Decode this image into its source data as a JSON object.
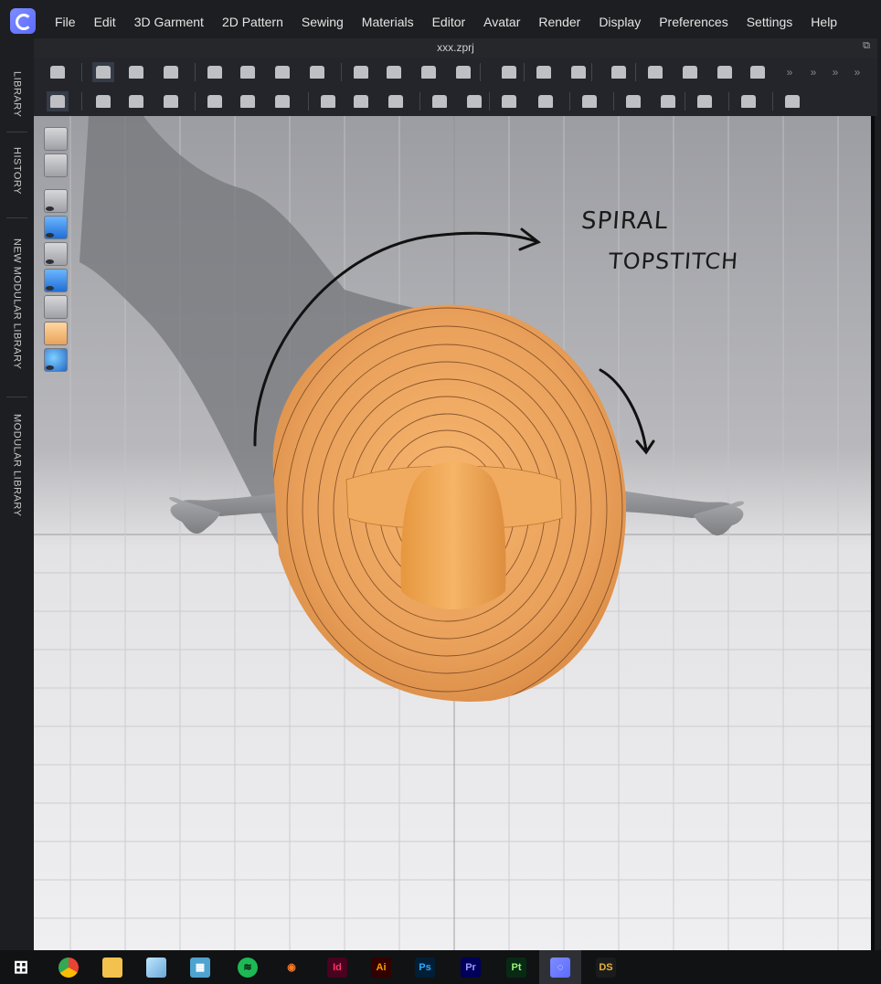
{
  "menubar": {
    "items": [
      "File",
      "Edit",
      "3D Garment",
      "2D Pattern",
      "Sewing",
      "Materials",
      "Editor",
      "Avatar",
      "Render",
      "Display",
      "Preferences",
      "Settings",
      "Help"
    ]
  },
  "sidebar": {
    "tabs": [
      "LIBRARY",
      "HISTORY",
      "NEW MODULAR LIBRARY",
      "MODULAR LIBRARY"
    ]
  },
  "file": {
    "title": "xxx.zprj"
  },
  "toolbar1": {
    "icons": [
      "import-icon",
      "transform-pattern-icon",
      "edit-pattern-icon",
      "transform-box-icon",
      "garment-simulate-icon",
      "garment-tuck-icon",
      "garment-fold-icon",
      "garment-strengthen-icon",
      "pin-icon",
      "fold-arrangement-icon",
      "fold-pattern-icon",
      "arrange-icon",
      "topstitch-icon",
      "button-tool-icon",
      "zipper-icon",
      "avatar-measure-icon",
      "fitting-icon",
      "garment-fit-map-icon",
      "tape-icon",
      "trims-icon"
    ]
  },
  "toolbar2": {
    "icons": [
      "simulation-icon",
      "select-mesh-icon",
      "pin-mesh-icon",
      "puckering-icon",
      "edit-sewing-icon",
      "segment-sewing-icon",
      "free-sewing-icon",
      "edit-texture-icon",
      "transform-graphic-icon",
      "button-icon",
      "buttonhole-icon",
      "line-sewing-icon",
      "lock-icon",
      "zip-icon",
      "solid-fold-icon",
      "puckering-strength-icon",
      "solid-shape-icon",
      "layer-clone-icon",
      "shrinkage-icon",
      "alignment-icon"
    ]
  },
  "viewport": {
    "icons": [
      "3d-view-icon",
      "2d-view-icon",
      "show-garment-icon",
      "show-pattern-icon",
      "show-avatar-icon",
      "show-fabric-icon",
      "show-solid-icon",
      "show-skin-icon",
      "show-environment-icon"
    ],
    "note": {
      "line1": "SPIRAL",
      "line2": "TOPSTITCH"
    },
    "colors": {
      "garment": "#f0a860",
      "avatar": "#8e8f93",
      "shadow": "#747579",
      "annotation": "#111111"
    }
  },
  "taskbar": {
    "apps": [
      {
        "name": "windows-start-icon",
        "label": ""
      },
      {
        "name": "chrome-icon",
        "label": ""
      },
      {
        "name": "file-explorer-icon",
        "label": ""
      },
      {
        "name": "notes-icon",
        "label": ""
      },
      {
        "name": "calculator-icon",
        "label": ""
      },
      {
        "name": "spotify-icon",
        "label": ""
      },
      {
        "name": "blender-icon",
        "label": ""
      },
      {
        "name": "indesign-icon",
        "label": "Id"
      },
      {
        "name": "illustrator-icon",
        "label": "Ai"
      },
      {
        "name": "photoshop-icon",
        "label": "Ps"
      },
      {
        "name": "premiere-icon",
        "label": "Pr"
      },
      {
        "name": "substance-painter-icon",
        "label": "Pt"
      },
      {
        "name": "clo3d-icon",
        "label": ""
      },
      {
        "name": "daz-studio-icon",
        "label": "DS"
      }
    ]
  }
}
